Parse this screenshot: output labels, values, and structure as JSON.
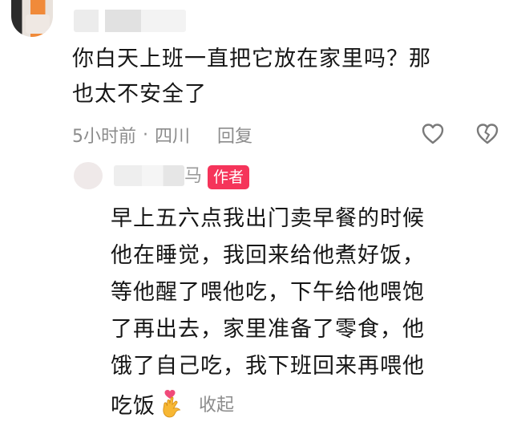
{
  "comment": {
    "text_line1": "你白天上班一直把它放在家里吗？那",
    "text_line2": "也太不安全了",
    "time": "5小时前",
    "separator": "·",
    "location": "四川",
    "reply_label": "回复",
    "like_icon": "heart-outline-icon",
    "dislike_icon": "broken-heart-icon"
  },
  "author_reply": {
    "name_tail": "马",
    "badge": "作者",
    "lines": [
      "早上五六点我出门卖早餐的时候",
      "他在睡觉，我回来给他煮好饭，",
      "等他醒了喂他吃，下午给他喂饱",
      "了再出去，家里准备了零食，他",
      "饿了自己吃，我下班回来再喂他"
    ],
    "last_line": "吃饭",
    "emoji": "heart-hands-emoji-icon",
    "collapse_label": "收起"
  },
  "colors": {
    "text": "#161616",
    "meta": "#8c8c8c",
    "badge_bg": "#f5345a"
  }
}
